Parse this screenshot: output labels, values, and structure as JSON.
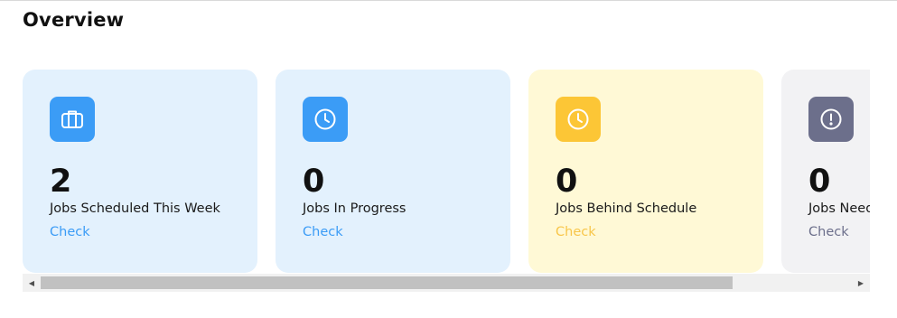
{
  "page": {
    "title": "Overview"
  },
  "colors": {
    "blue_card": "#e3f1fd",
    "yellow_card": "#fff9d6",
    "grey_card": "#f2f2f4",
    "blue_icon": "#3b9cf6",
    "yellow_icon": "#fcc636",
    "grey_icon": "#6c6f8b"
  },
  "cards": [
    {
      "icon": "briefcase-icon",
      "count": "2",
      "label": "Jobs Scheduled This Week",
      "link": "Check"
    },
    {
      "icon": "clock-icon",
      "count": "0",
      "label": "Jobs In Progress",
      "link": "Check"
    },
    {
      "icon": "clock-icon",
      "count": "0",
      "label": "Jobs Behind Schedule",
      "link": "Check"
    },
    {
      "icon": "alert-circle-icon",
      "count": "0",
      "label": "Jobs Needing Attention",
      "link": "Check"
    }
  ],
  "scrollbar": {
    "left_arrow": "◀",
    "right_arrow": "▶"
  }
}
